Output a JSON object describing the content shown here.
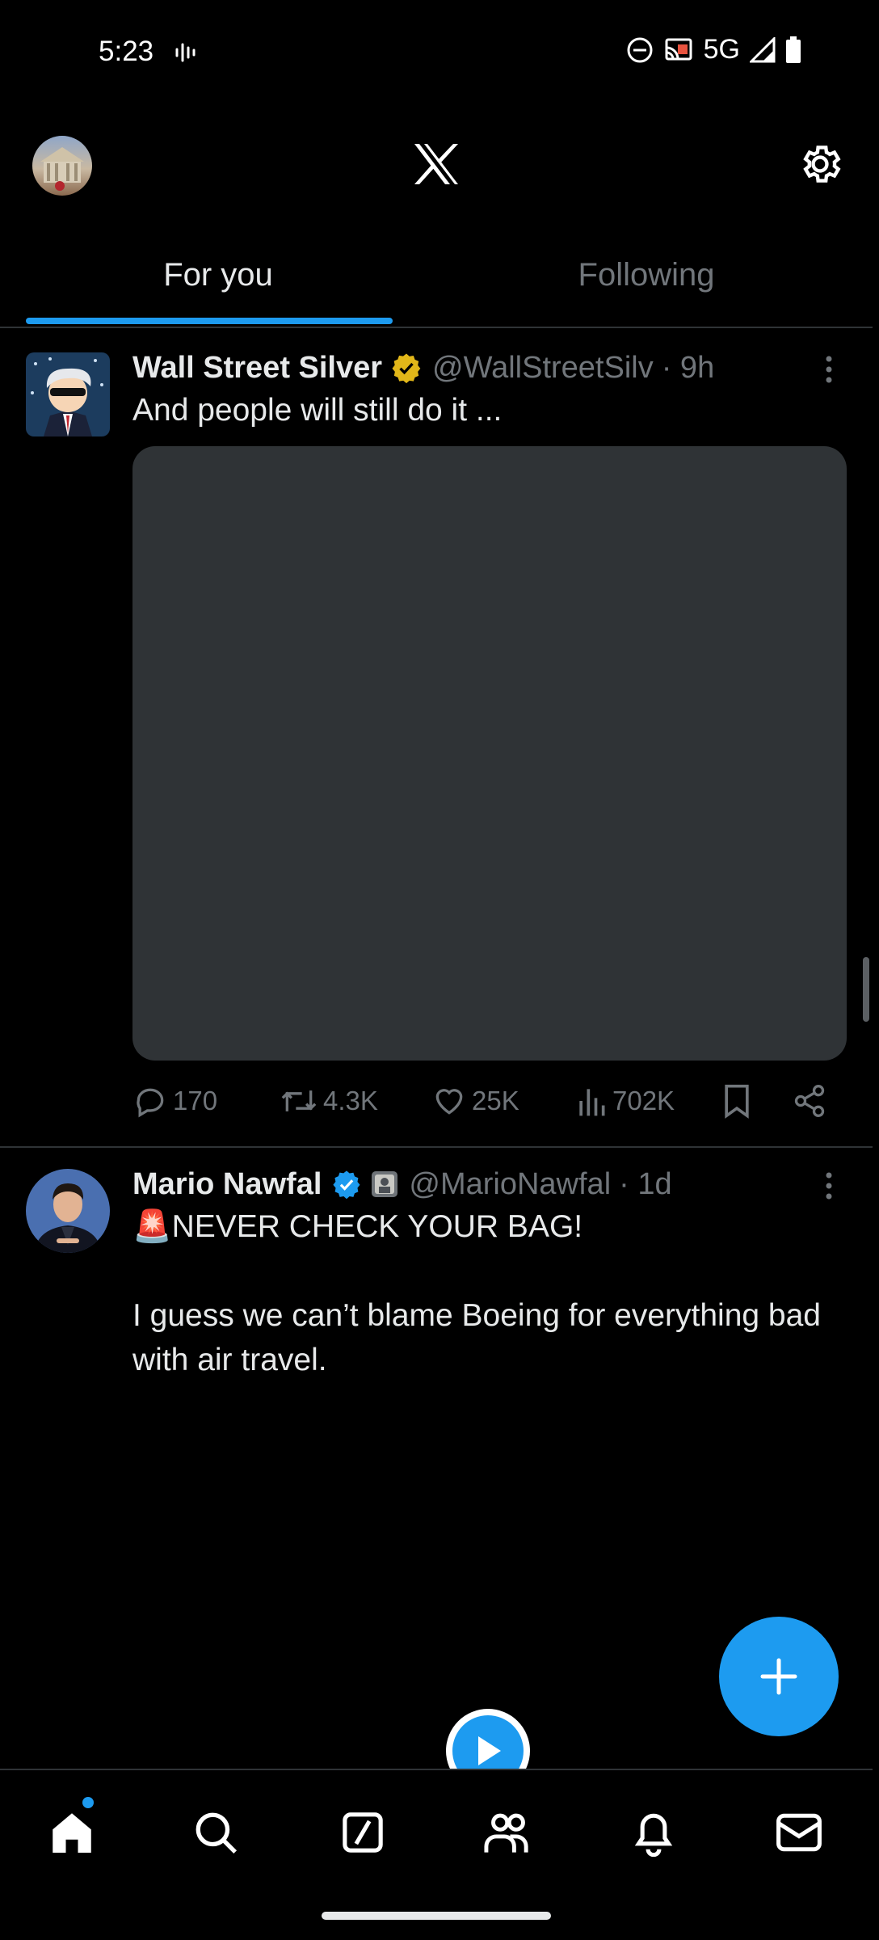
{
  "status_bar": {
    "time": "5:23",
    "network": "5G"
  },
  "header": {
    "logo": "x-logo",
    "settings_icon": "gear-icon"
  },
  "tabs": [
    {
      "label": "For you",
      "active": true
    },
    {
      "label": "Following",
      "active": false
    }
  ],
  "tweets": [
    {
      "name": "Wall Street Silver",
      "verified": "gold",
      "handle": "@WallStreetSilv",
      "time": "· 9h",
      "text": "And people will still do it ...",
      "has_media": true,
      "replies": "170",
      "reposts": "4.3K",
      "likes": "25K",
      "views": "702K"
    },
    {
      "name": "Mario Nawfal",
      "verified": "blue",
      "handle": "@MarioNawfal",
      "time": "· 1d",
      "emoji": "🚨",
      "text_line1": "NEVER CHECK YOUR BAG!",
      "text_line2": "I guess we can’t blame Boeing for everything bad with air travel."
    }
  ],
  "colors": {
    "accent": "#1d9bf0",
    "gold_badge": "#e2b719",
    "bg": "#000000",
    "muted": "#71767b"
  },
  "nav": [
    {
      "icon": "home-icon",
      "active": true,
      "badge": true
    },
    {
      "icon": "search-icon"
    },
    {
      "icon": "grok-icon"
    },
    {
      "icon": "communities-icon"
    },
    {
      "icon": "notifications-icon"
    },
    {
      "icon": "messages-icon"
    }
  ]
}
